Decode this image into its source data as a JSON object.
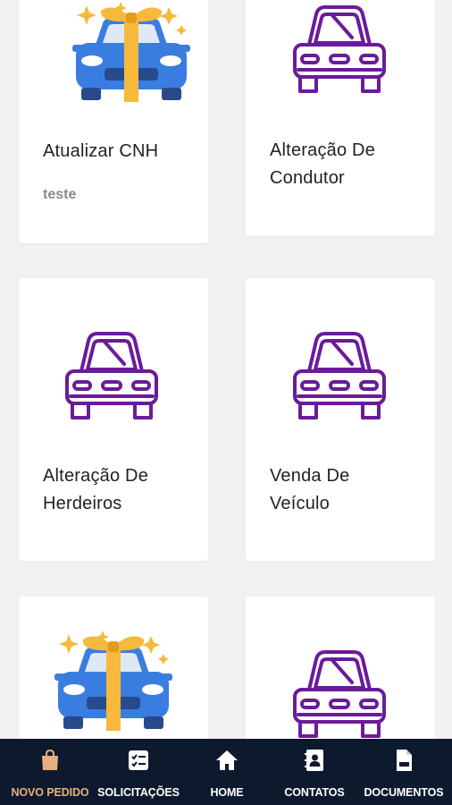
{
  "cards": [
    {
      "title_line1": "Atualizar CNH",
      "title_line2": "",
      "subtitle": "teste",
      "icon": "gift-car-icon"
    },
    {
      "title_line1": "Alteração De",
      "title_line2": "Condutor",
      "subtitle": "",
      "icon": "car-outline-icon"
    },
    {
      "title_line1": "Alteração De",
      "title_line2": "Herdeiros",
      "subtitle": "",
      "icon": "car-outline-icon"
    },
    {
      "title_line1": "Venda De",
      "title_line2": "Veículo",
      "subtitle": "",
      "icon": "car-outline-icon"
    },
    {
      "title_line1": "",
      "title_line2": "",
      "subtitle": "",
      "icon": "gift-car-icon"
    },
    {
      "title_line1": "",
      "title_line2": "",
      "subtitle": "",
      "icon": "car-outline-icon"
    }
  ],
  "nav": {
    "items": [
      {
        "label": "NOVO PEDIDO",
        "icon": "shopping-bag-icon"
      },
      {
        "label": "SOLICITAÇÕES",
        "icon": "checklist-icon"
      },
      {
        "label": "HOME",
        "icon": "home-icon"
      },
      {
        "label": "CONTATOS",
        "icon": "contacts-book-icon"
      },
      {
        "label": "DOCUMENTOS",
        "icon": "document-icon"
      }
    ]
  },
  "colors": {
    "background": "#f1f1f1",
    "card": "#ffffff",
    "car_outline": "#6a1b9a",
    "car_blue": "#3a7de0",
    "ribbon": "#f6b93b",
    "nav_bg": "#0d1a2e",
    "nav_active": "#e8b07f",
    "nav_text": "#ffffff"
  }
}
